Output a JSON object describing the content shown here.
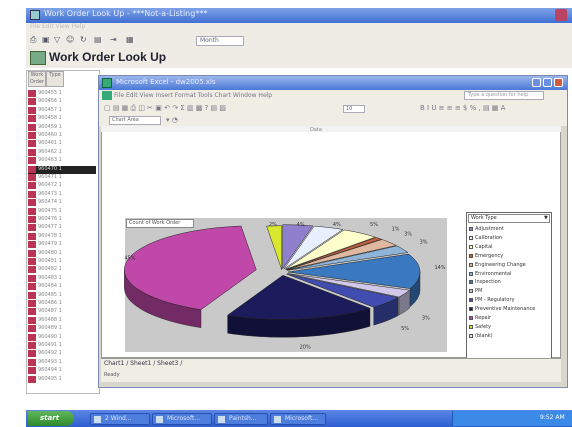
{
  "outer_app": {
    "window_title": "Work Order Look Up - ***Not-a-Listing***",
    "menu_text": "File  Edit  View  Help",
    "filter_value": "Month",
    "page_title": "Work Order Look Up"
  },
  "work_order_list": {
    "columns": [
      "Work Order",
      "Type"
    ],
    "selected_index": 9,
    "rows": [
      {
        "number": "960455",
        "type": "1"
      },
      {
        "number": "960456",
        "type": "1"
      },
      {
        "number": "960457",
        "type": "1"
      },
      {
        "number": "960458",
        "type": "1"
      },
      {
        "number": "960459",
        "type": "1"
      },
      {
        "number": "960460",
        "type": "1"
      },
      {
        "number": "960461",
        "type": "1"
      },
      {
        "number": "960462",
        "type": "1"
      },
      {
        "number": "960463",
        "type": "1"
      },
      {
        "number": "960470",
        "type": "1"
      },
      {
        "number": "960471",
        "type": "1"
      },
      {
        "number": "960472",
        "type": "1"
      },
      {
        "number": "960473",
        "type": "1"
      },
      {
        "number": "960474",
        "type": "1"
      },
      {
        "number": "960475",
        "type": "1"
      },
      {
        "number": "960476",
        "type": "1"
      },
      {
        "number": "960477",
        "type": "1"
      },
      {
        "number": "960478",
        "type": "1"
      },
      {
        "number": "960479",
        "type": "1"
      },
      {
        "number": "960480",
        "type": "1"
      },
      {
        "number": "960481",
        "type": "1"
      },
      {
        "number": "960482",
        "type": "1"
      },
      {
        "number": "960483",
        "type": "1"
      },
      {
        "number": "960484",
        "type": "1"
      },
      {
        "number": "960485",
        "type": "1"
      },
      {
        "number": "960486",
        "type": "1"
      },
      {
        "number": "960487",
        "type": "1"
      },
      {
        "number": "960488",
        "type": "1"
      },
      {
        "number": "960489",
        "type": "1"
      },
      {
        "number": "960490",
        "type": "1"
      },
      {
        "number": "960491",
        "type": "1"
      },
      {
        "number": "960492",
        "type": "1"
      },
      {
        "number": "960493",
        "type": "1"
      },
      {
        "number": "960494",
        "type": "1"
      },
      {
        "number": "960495",
        "type": "1"
      }
    ]
  },
  "excel": {
    "window_title": "Microsoft Excel - dw2005.xls",
    "menu_text": "File  Edit  View  Insert  Format  Tools  Chart  Window  Help",
    "help_placeholder": "Type a question for help",
    "chart_area_box": "Chart Area",
    "font_size": "10",
    "sheet_top_label": "Data",
    "sheet_tabs": "Chart1 / Sheet1 / Sheet3 /",
    "status": "Ready"
  },
  "chart_data": {
    "type": "pie",
    "title": "Count of Work Order",
    "legend_title": "Work Type",
    "legend_placement": "right",
    "slices": [
      {
        "label": "Adjustment",
        "value": 4,
        "percent_label": "4%",
        "color": "#8e80cc"
      },
      {
        "label": "Calibration",
        "value": 4,
        "percent_label": "4%",
        "color": "#e8f0ff"
      },
      {
        "label": "Capital",
        "value": 5,
        "percent_label": "5%",
        "color": "#ffffcc"
      },
      {
        "label": "Emergency",
        "value": 1,
        "percent_label": "1%",
        "color": "#c06040"
      },
      {
        "label": "Engineering Change",
        "value": 3,
        "percent_label": "3%",
        "color": "#e0b8a0"
      },
      {
        "label": "Environmental",
        "value": 3,
        "percent_label": "3%",
        "color": "#8fb4d8"
      },
      {
        "label": "Inspection",
        "value": 14,
        "percent_label": "14%",
        "color": "#3a78c0"
      },
      {
        "label": "PM",
        "value": 3,
        "percent_label": "3%",
        "color": "#cfc8e8"
      },
      {
        "label": "PM - Regulatory",
        "value": 5,
        "percent_label": "5%",
        "color": "#404cb0"
      },
      {
        "label": "Preventive Maintenance",
        "value": 20,
        "percent_label": "20%",
        "color": "#1c1c5c"
      },
      {
        "label": "Repair",
        "value": 45,
        "percent_label": "45%",
        "color": "#c048a8"
      },
      {
        "label": "Safety",
        "value": 2,
        "percent_label": "2%",
        "color": "#d8e830"
      },
      {
        "label": "(blank)",
        "value": 0,
        "percent_label": "0%",
        "color": "#e8e8e8"
      }
    ]
  },
  "taskbar": {
    "start_label": "start",
    "buttons": [
      "2 Wind...",
      "Microsoft...",
      "Paintsh...",
      "Microsoft..."
    ],
    "clock": "9:52 AM"
  }
}
